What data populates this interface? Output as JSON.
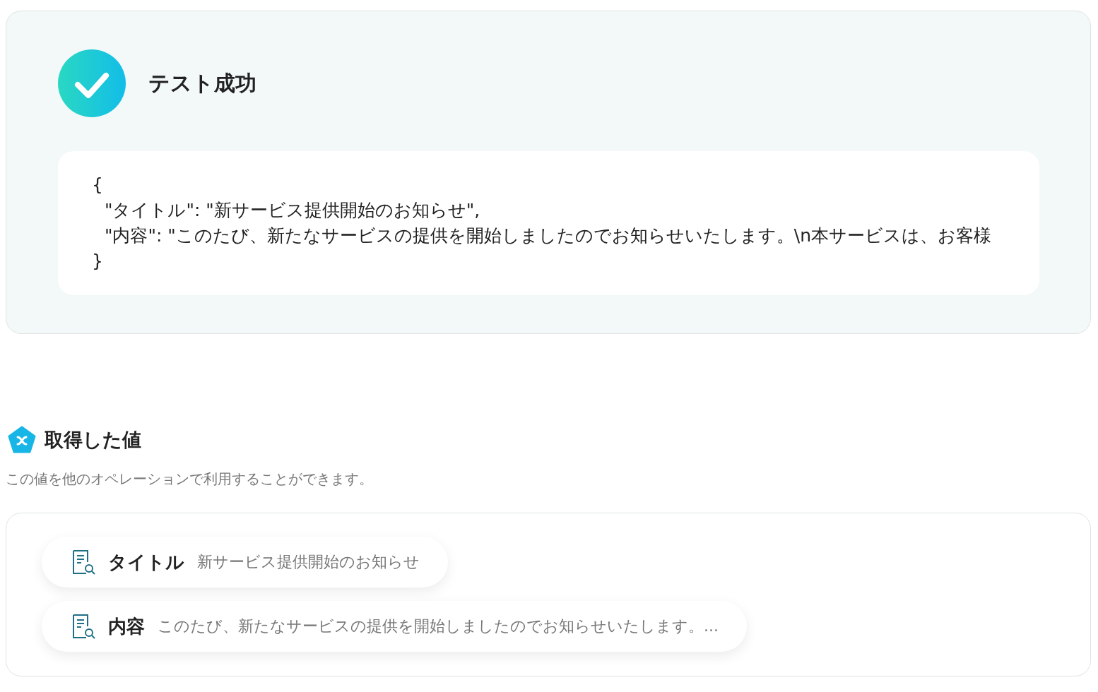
{
  "result": {
    "succeeded": true,
    "title": "テスト成功",
    "code": {
      "open": "{",
      "entries": [
        "\"タイトル\": \"新サービス提供開始のお知らせ\",",
        "\"内容\": \"このたび、新たなサービスの提供を開始しましたのでお知らせいたします。\\n本サービスは、お客様"
      ],
      "close": "}"
    }
  },
  "values": {
    "title": "取得した値",
    "description": "この値を他のオペレーションで利用することができます。",
    "items": [
      {
        "label": "タイトル",
        "value": "新サービス提供開始のお知らせ"
      },
      {
        "label": "内容",
        "value": "このたび、新たなサービスの提供を開始しましたのでお知らせいたします。..."
      }
    ]
  }
}
